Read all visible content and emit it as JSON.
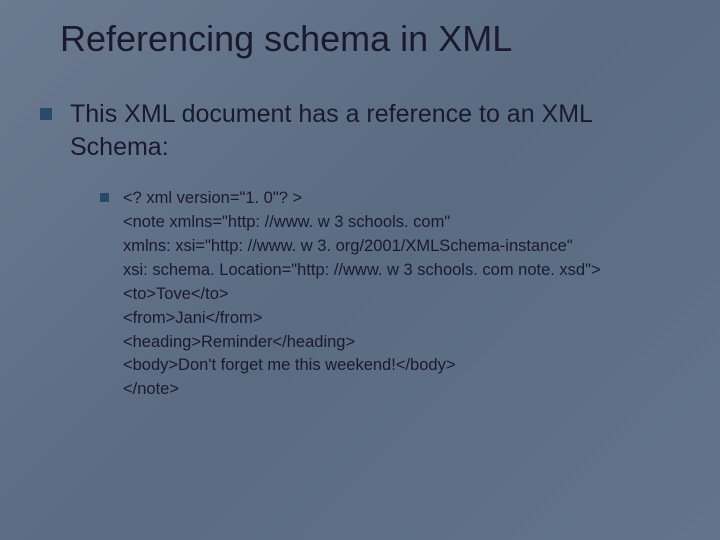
{
  "slide": {
    "title": "Referencing schema in XML",
    "main_bullet": "This XML document has a reference to an XML Schema:",
    "code_lines": [
      "<? xml version=\"1. 0\"? >",
      "<note xmlns=\"http: //www. w 3 schools. com\"",
      "xmlns: xsi=\"http: //www. w 3. org/2001/XMLSchema-instance\"",
      "xsi: schema. Location=\"http: //www. w 3 schools. com note. xsd\">",
      "<to>Tove</to>",
      "<from>Jani</from>",
      "<heading>Reminder</heading>",
      "<body>Don't forget me this weekend!</body>",
      "</note>"
    ]
  }
}
